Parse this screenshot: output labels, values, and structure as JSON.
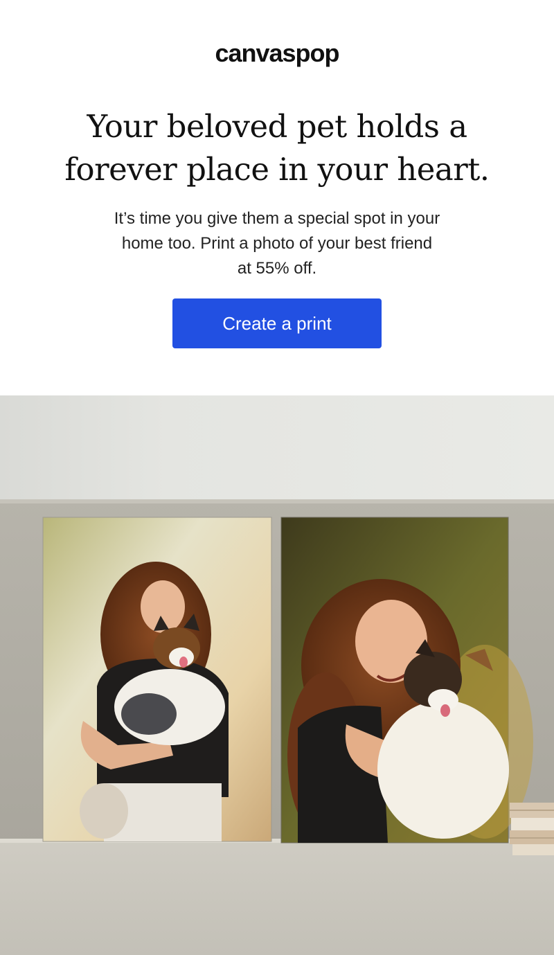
{
  "brand": {
    "logo_text": "canvaspop"
  },
  "hero": {
    "headline_line1": "Your beloved pet holds a",
    "headline_line2": "forever place in your heart.",
    "body_line1": "It’s time you give them a special spot in your",
    "body_line2": "home too. Print a photo of your best friend",
    "body_line3": "at 55% off.",
    "cta_label": "Create a print"
  },
  "colors": {
    "cta_background": "#2250e2",
    "cta_text": "#ffffff",
    "page_background": "#ffffff"
  },
  "images": {
    "product_photo": "lifestyle-canvas-prints-on-sofa",
    "canvas_left": "woman-hugging-dog-canvas",
    "canvas_right": "woman-hugging-dog-closeup-canvas"
  }
}
